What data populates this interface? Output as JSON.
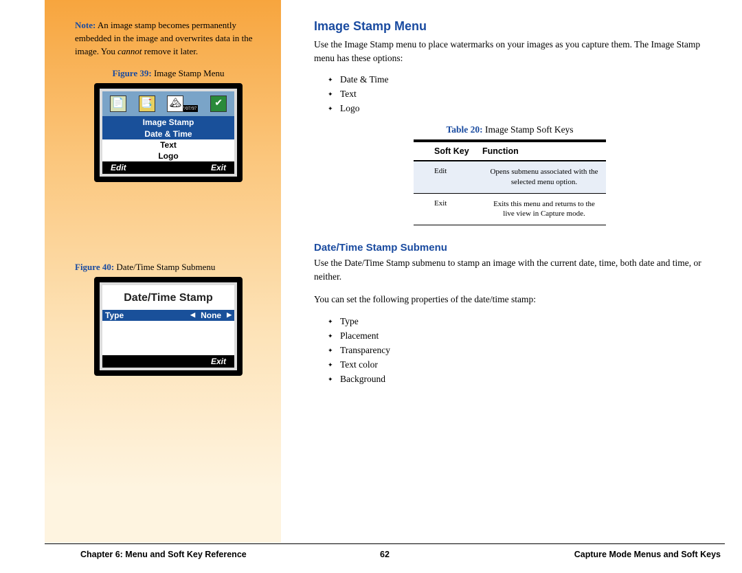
{
  "sidebar": {
    "note_label": "Note:",
    "note_text_1": " An image stamp becomes permanently embedded in the image and overwrites data in the image. You ",
    "note_em": "cannot",
    "note_text_2": " remove it later.",
    "fig39_label": "Figure 39:",
    "fig39_text": " Image Stamp Menu",
    "fig39_screen": {
      "icon_date": "07/07/97",
      "title": "Image Stamp",
      "items": [
        "Date & Time",
        "Text",
        "Logo"
      ],
      "soft_left": "Edit",
      "soft_right": "Exit"
    },
    "fig40_label": "Figure 40:",
    "fig40_text": " Date/Time Stamp Submenu",
    "fig40_screen": {
      "title": "Date/Time Stamp",
      "row_left": "Type",
      "row_right": "None",
      "soft_right": "Exit"
    }
  },
  "main": {
    "h1": "Image Stamp Menu",
    "p1": "Use the Image Stamp menu to place watermarks on your images as you capture them. The Image Stamp menu has these options:",
    "list1": [
      "Date & Time",
      "Text",
      "Logo"
    ],
    "table_caption_label": "Table 20:",
    "table_caption_text": " Image Stamp Soft Keys",
    "table_head": {
      "c1": "Soft Key",
      "c2": "Function"
    },
    "table_rows": [
      {
        "c1": "Edit",
        "c2": "Opens submenu associated with the selected menu option."
      },
      {
        "c1": "Exit",
        "c2": "Exits this menu and returns to the live view in Capture mode."
      }
    ],
    "h2": "Date/Time Stamp Submenu",
    "p2": "Use the Date/Time Stamp submenu to stamp an image with the current date, time, both date and time, or neither.",
    "p3": "You can set the following properties of the date/time stamp:",
    "list2": [
      "Type",
      "Placement",
      "Transparency",
      "Text color",
      "Background"
    ]
  },
  "footer": {
    "left": "Chapter 6: Menu and Soft Key Reference",
    "center": "62",
    "right": "Capture Mode Menus and Soft Keys"
  }
}
